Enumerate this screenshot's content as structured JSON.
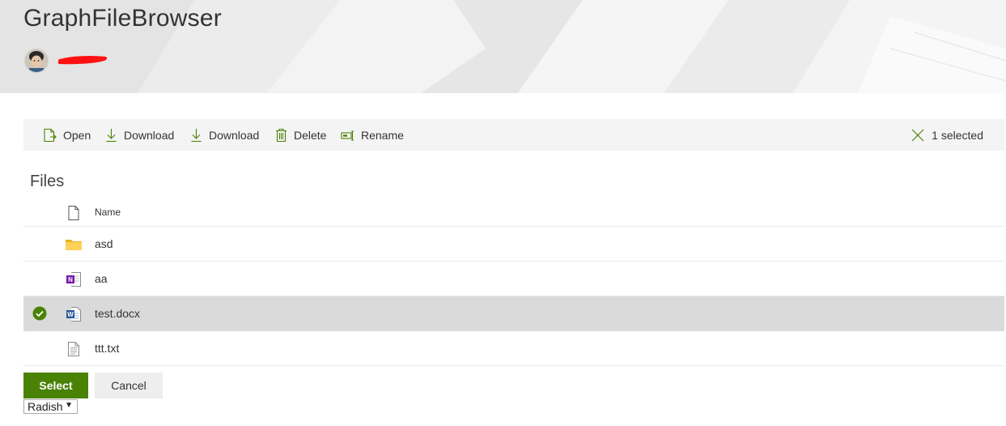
{
  "app": {
    "title": "GraphFileBrowser"
  },
  "toolbar": {
    "items": [
      {
        "label": "Open",
        "icon": "open-file-icon"
      },
      {
        "label": "Download",
        "icon": "download-icon"
      },
      {
        "label": "Download",
        "icon": "download-icon"
      },
      {
        "label": "Delete",
        "icon": "trash-icon"
      },
      {
        "label": "Rename",
        "icon": "rename-icon"
      }
    ],
    "selection_status": "1 selected"
  },
  "files": {
    "title": "Files",
    "column_name": "Name",
    "items": [
      {
        "name": "asd",
        "type": "folder",
        "selected": false
      },
      {
        "name": "aa",
        "type": "onenote",
        "selected": false
      },
      {
        "name": "test.docx",
        "type": "word",
        "selected": true
      },
      {
        "name": "ttt.txt",
        "type": "text",
        "selected": false
      }
    ]
  },
  "actions": {
    "select_label": "Select",
    "cancel_label": "Cancel"
  },
  "theme_select": {
    "value": "Radish"
  },
  "colors": {
    "accent": "#498205",
    "selected_row": "#dadada",
    "command_bar": "#f4f4f4"
  }
}
